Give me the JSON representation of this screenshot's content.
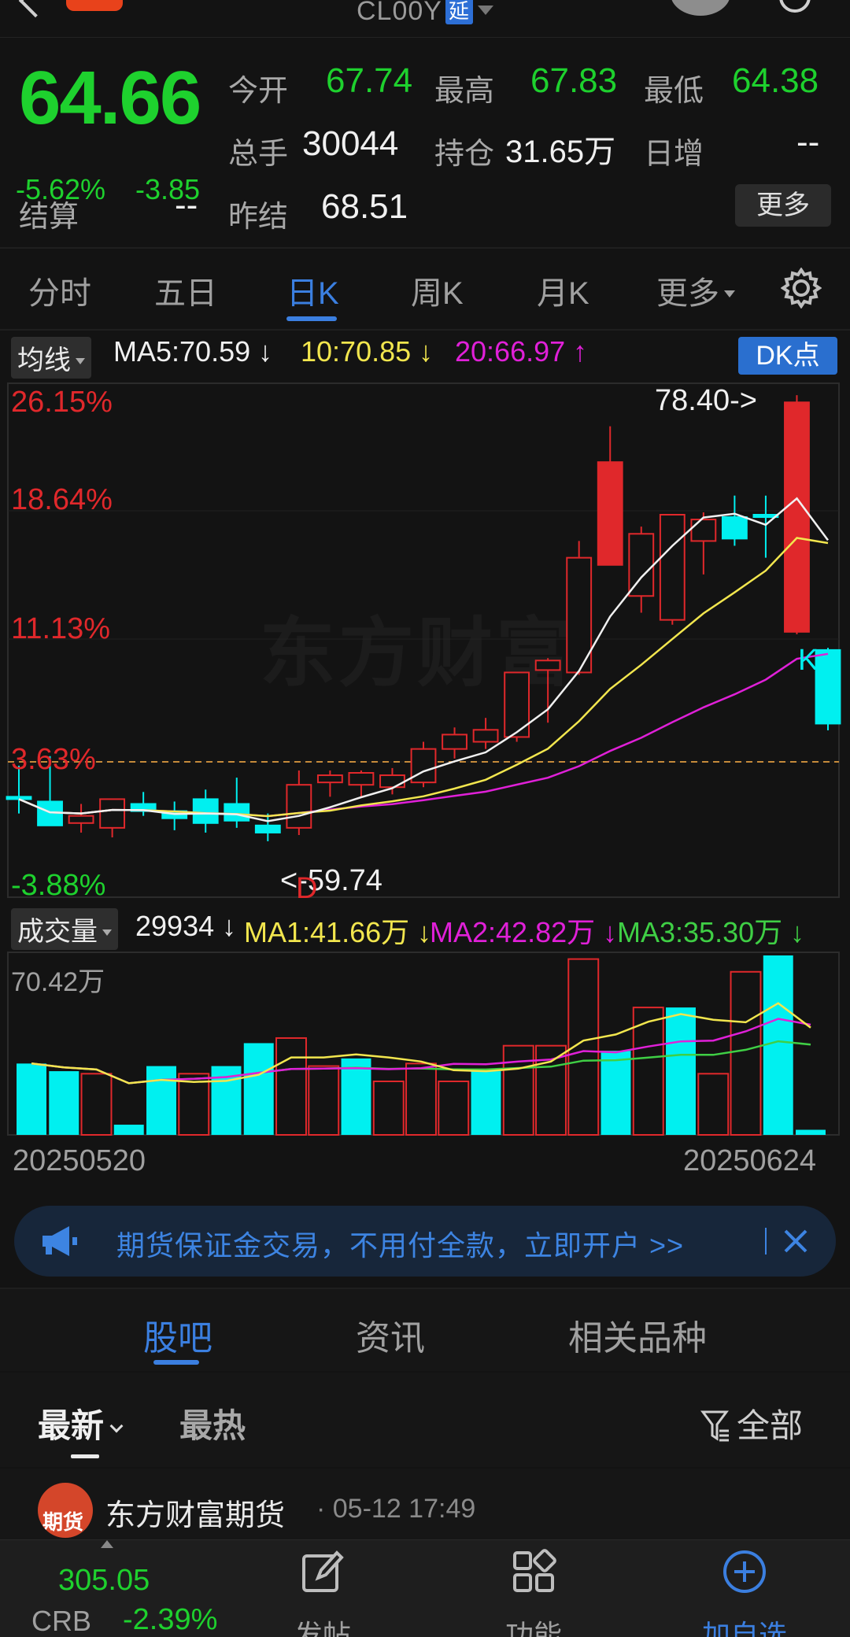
{
  "header": {
    "symbol": "CL00Y",
    "delay_badge": "延"
  },
  "quote": {
    "price": "64.66",
    "change_pct": "-5.62%",
    "change": "-3.85",
    "open_label": "今开",
    "open": "67.74",
    "high_label": "最高",
    "high": "67.83",
    "low_label": "最低",
    "low": "64.38",
    "volume_label": "总手",
    "volume": "30044",
    "oi_label": "持仓",
    "oi": "31.65万",
    "daily_inc_label": "日增",
    "daily_inc": "--",
    "settle_label": "结算",
    "settle": "--",
    "prev_settle_label": "昨结",
    "prev_settle": "68.51",
    "more_label": "更多"
  },
  "tabs": [
    {
      "label": "分时"
    },
    {
      "label": "五日"
    },
    {
      "label": "日K"
    },
    {
      "label": "周K"
    },
    {
      "label": "月K"
    },
    {
      "label": "更多"
    }
  ],
  "ma": {
    "selector": "均线",
    "ma5": "MA5:70.59 ↓",
    "ma10": "10:70.85 ↓",
    "ma20": "20:66.97 ↑",
    "dk_button": "DK点"
  },
  "chart_data": {
    "type": "candlestick",
    "x_start": "20250520",
    "x_end": "20250624",
    "pct_ticks": [
      "26.15%",
      "18.64%",
      "11.13%",
      "3.63%",
      "-3.88%"
    ],
    "ylim": [
      59.74,
      78.4
    ],
    "high_label": "78.40->",
    "low_label": "<-59.74",
    "marker_d": "D",
    "marker_k": "K",
    "watermark": "东方财富",
    "up_color": "#e0282b",
    "down_color": "#00f0f0",
    "candles": [
      {
        "o": 61.6,
        "h": 62.9,
        "l": 60.9,
        "c": 61.5
      },
      {
        "o": 61.4,
        "h": 63.3,
        "l": 60.6,
        "c": 60.4
      },
      {
        "o": 60.5,
        "h": 61.3,
        "l": 60.1,
        "c": 60.8
      },
      {
        "o": 60.3,
        "h": 61.4,
        "l": 59.9,
        "c": 61.5
      },
      {
        "o": 61.3,
        "h": 61.8,
        "l": 60.8,
        "c": 61.0
      },
      {
        "o": 61.0,
        "h": 61.4,
        "l": 60.2,
        "c": 60.7
      },
      {
        "o": 61.5,
        "h": 61.9,
        "l": 60.1,
        "c": 60.5
      },
      {
        "o": 61.3,
        "h": 62.4,
        "l": 60.3,
        "c": 60.6
      },
      {
        "o": 60.4,
        "h": 60.9,
        "l": 59.74,
        "c": 60.1
      },
      {
        "o": 60.3,
        "h": 62.7,
        "l": 60.0,
        "c": 62.1
      },
      {
        "o": 62.2,
        "h": 62.7,
        "l": 61.6,
        "c": 62.5
      },
      {
        "o": 62.1,
        "h": 62.7,
        "l": 61.6,
        "c": 62.6
      },
      {
        "o": 62.0,
        "h": 62.8,
        "l": 61.7,
        "c": 62.5
      },
      {
        "o": 62.2,
        "h": 63.9,
        "l": 62.0,
        "c": 63.6
      },
      {
        "o": 63.6,
        "h": 64.5,
        "l": 63.2,
        "c": 64.2
      },
      {
        "o": 63.9,
        "h": 64.9,
        "l": 63.6,
        "c": 64.4
      },
      {
        "o": 64.1,
        "h": 65.6,
        "l": 63.9,
        "c": 66.8
      },
      {
        "o": 66.9,
        "h": 67.4,
        "l": 64.7,
        "c": 67.3
      },
      {
        "o": 66.8,
        "h": 72.3,
        "l": 66.7,
        "c": 71.6
      },
      {
        "o": 71.3,
        "h": 77.1,
        "l": 71.7,
        "c": 75.6
      },
      {
        "o": 70.0,
        "h": 72.9,
        "l": 69.3,
        "c": 72.6
      },
      {
        "o": 69.0,
        "h": 73.1,
        "l": 68.8,
        "c": 73.4
      },
      {
        "o": 72.3,
        "h": 73.5,
        "l": 70.9,
        "c": 73.2
      },
      {
        "o": 73.3,
        "h": 74.2,
        "l": 72.1,
        "c": 72.4
      },
      {
        "o": 73.4,
        "h": 74.2,
        "l": 71.6,
        "c": 73.3
      },
      {
        "o": 68.5,
        "h": 78.4,
        "l": 68.4,
        "c": 78.1
      },
      {
        "o": 67.74,
        "h": 67.83,
        "l": 64.38,
        "c": 64.66
      }
    ]
  },
  "volume": {
    "selector": "成交量",
    "value": "29934 ↓",
    "ma1": "MA1:41.66万 ↓",
    "ma2": "MA2:42.82万 ↓",
    "ma3": "MA3:35.30万 ↓",
    "max_label": "70.42万",
    "bars": [
      {
        "v": 28,
        "up": false
      },
      {
        "v": 25,
        "up": false
      },
      {
        "v": 24,
        "up": true
      },
      {
        "v": 4,
        "up": false
      },
      {
        "v": 27,
        "up": false
      },
      {
        "v": 24,
        "up": true
      },
      {
        "v": 27,
        "up": false
      },
      {
        "v": 36,
        "up": false
      },
      {
        "v": 38,
        "up": true
      },
      {
        "v": 27,
        "up": true
      },
      {
        "v": 30,
        "up": false
      },
      {
        "v": 21,
        "up": true
      },
      {
        "v": 28,
        "up": true
      },
      {
        "v": 21,
        "up": true
      },
      {
        "v": 25,
        "up": false
      },
      {
        "v": 35,
        "up": true
      },
      {
        "v": 35,
        "up": true
      },
      {
        "v": 69,
        "up": true
      },
      {
        "v": 33,
        "up": false
      },
      {
        "v": 50,
        "up": true
      },
      {
        "v": 50,
        "up": false
      },
      {
        "v": 24,
        "up": true
      },
      {
        "v": 64,
        "up": true
      },
      {
        "v": 70.42,
        "up": false
      },
      {
        "v": 2,
        "up": false
      }
    ]
  },
  "banner": {
    "text": "期货保证金交易，不用付全款，立即开户 >>"
  },
  "sub_tabs": [
    {
      "label": "股吧"
    },
    {
      "label": "资讯"
    },
    {
      "label": "相关品种"
    }
  ],
  "filters": {
    "latest": "最新",
    "hot": "最热",
    "all": "全部"
  },
  "post": {
    "author": "东方财富期货",
    "time": "· 05-12 17:49",
    "avatar_text": "期货"
  },
  "bottom_nav": {
    "crb_value": "305.05",
    "crb_label": "CRB",
    "crb_pct": "-2.39%",
    "items": [
      {
        "label": "发帖"
      },
      {
        "label": "功能"
      },
      {
        "label": "加自选"
      }
    ]
  }
}
